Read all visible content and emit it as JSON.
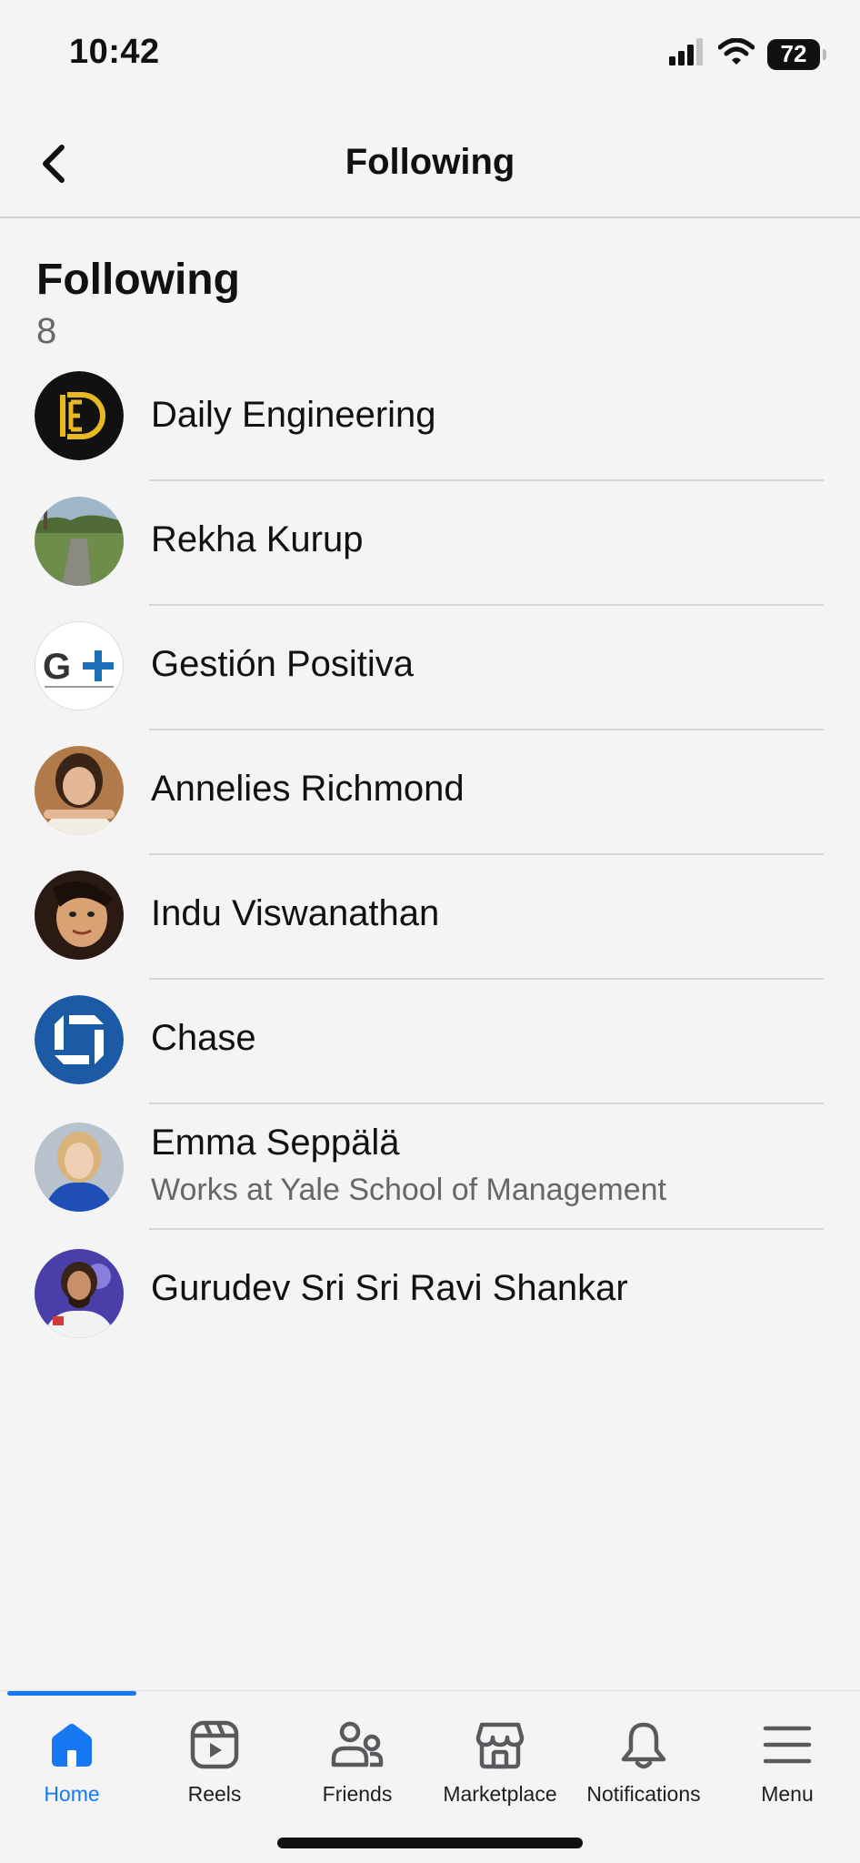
{
  "status_bar": {
    "time": "10:42",
    "battery": "72"
  },
  "header": {
    "title": "Following"
  },
  "section": {
    "title": "Following",
    "count": "8"
  },
  "following": [
    {
      "name": "Daily Engineering",
      "subtitle": "",
      "avatar": "daily-engineering-logo"
    },
    {
      "name": "Rekha Kurup",
      "subtitle": "",
      "avatar": "landscape-photo"
    },
    {
      "name": "Gestión Positiva",
      "subtitle": "",
      "avatar": "gestion-positiva-logo"
    },
    {
      "name": "Annelies Richmond",
      "subtitle": "",
      "avatar": "profile-photo"
    },
    {
      "name": "Indu Viswanathan",
      "subtitle": "",
      "avatar": "profile-photo"
    },
    {
      "name": "Chase",
      "subtitle": "",
      "avatar": "chase-logo"
    },
    {
      "name": "Emma Seppälä",
      "subtitle": "Works at Yale School of Management",
      "avatar": "profile-photo"
    },
    {
      "name": "Gurudev Sri Sri Ravi Shankar",
      "subtitle": "",
      "avatar": "profile-photo"
    }
  ],
  "tab_bar": {
    "tabs": [
      {
        "label": "Home",
        "icon": "home-icon",
        "active": true
      },
      {
        "label": "Reels",
        "icon": "reels-icon",
        "active": false
      },
      {
        "label": "Friends",
        "icon": "friends-icon",
        "active": false
      },
      {
        "label": "Marketplace",
        "icon": "marketplace-icon",
        "active": false
      },
      {
        "label": "Notifications",
        "icon": "bell-icon",
        "active": false
      },
      {
        "label": "Menu",
        "icon": "menu-icon",
        "active": false
      }
    ]
  },
  "colors": {
    "accent": "#1877f2",
    "background": "#f4f4f5",
    "secondary_text": "#65676b",
    "chase_blue": "#1c5aa6"
  }
}
